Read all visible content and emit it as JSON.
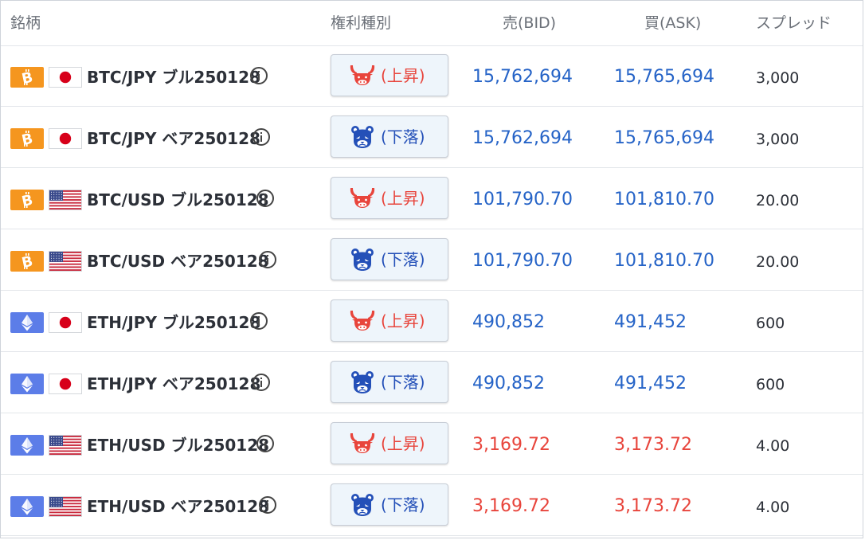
{
  "header": {
    "symbol": "銘柄",
    "type": "権利種別",
    "bid": "売(BID)",
    "ask": "買(ASK)",
    "spread": "スプレッド"
  },
  "colors": {
    "price_blue": "#2563c7",
    "price_red": "#e8453c",
    "btc_badge": "#f5961f",
    "eth_badge": "#5c7de8"
  },
  "rows": [
    {
      "coin": "btc",
      "flag": "jp",
      "name": "BTC/JPY ブル250128",
      "type": "bull",
      "type_label": "(上昇)",
      "bid": "15,762,694",
      "ask": "15,765,694",
      "spread": "3,000",
      "price_color": "blue"
    },
    {
      "coin": "btc",
      "flag": "jp",
      "name": "BTC/JPY ベア250128",
      "type": "bear",
      "type_label": "(下落)",
      "bid": "15,762,694",
      "ask": "15,765,694",
      "spread": "3,000",
      "price_color": "blue"
    },
    {
      "coin": "btc",
      "flag": "us",
      "name": "BTC/USD ブル250128",
      "type": "bull",
      "type_label": "(上昇)",
      "bid": "101,790.70",
      "ask": "101,810.70",
      "spread": "20.00",
      "price_color": "blue"
    },
    {
      "coin": "btc",
      "flag": "us",
      "name": "BTC/USD ベア250128",
      "type": "bear",
      "type_label": "(下落)",
      "bid": "101,790.70",
      "ask": "101,810.70",
      "spread": "20.00",
      "price_color": "blue"
    },
    {
      "coin": "eth",
      "flag": "jp",
      "name": "ETH/JPY ブル250128",
      "type": "bull",
      "type_label": "(上昇)",
      "bid": "490,852",
      "ask": "491,452",
      "spread": "600",
      "price_color": "blue"
    },
    {
      "coin": "eth",
      "flag": "jp",
      "name": "ETH/JPY ベア250128",
      "type": "bear",
      "type_label": "(下落)",
      "bid": "490,852",
      "ask": "491,452",
      "spread": "600",
      "price_color": "blue"
    },
    {
      "coin": "eth",
      "flag": "us",
      "name": "ETH/USD ブル250128",
      "type": "bull",
      "type_label": "(上昇)",
      "bid": "3,169.72",
      "ask": "3,173.72",
      "spread": "4.00",
      "price_color": "red"
    },
    {
      "coin": "eth",
      "flag": "us",
      "name": "ETH/USD ベア250128",
      "type": "bear",
      "type_label": "(下落)",
      "bid": "3,169.72",
      "ask": "3,173.72",
      "spread": "4.00",
      "price_color": "red"
    }
  ]
}
